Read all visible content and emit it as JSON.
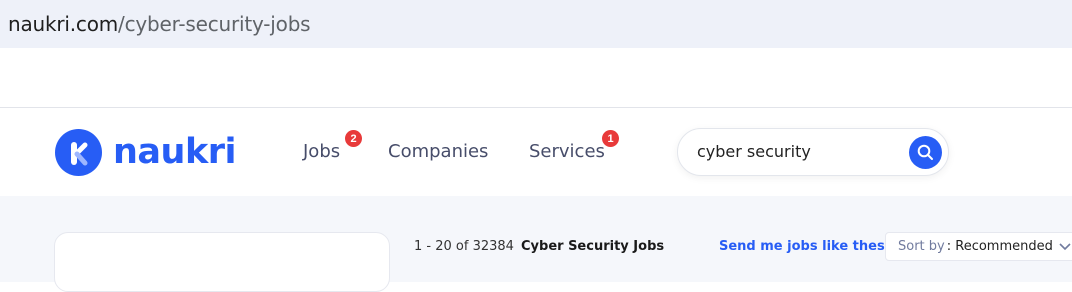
{
  "browser": {
    "url_host": "naukri.com",
    "url_path": "/cyber-security-jobs"
  },
  "header": {
    "logo_text": "naukri",
    "nav": {
      "jobs": {
        "label": "Jobs",
        "badge": "2"
      },
      "companies": {
        "label": "Companies"
      },
      "services": {
        "label": "Services",
        "badge": "1"
      }
    },
    "search": {
      "value": "cyber security",
      "icon": "search-icon"
    }
  },
  "results": {
    "count_text": "1 - 20 of 32384",
    "query_title": "Cyber Security Jobs",
    "send_jobs_label": "Send me jobs like these",
    "sort_label": "Sort by",
    "sort_value": ": Recommended"
  },
  "colors": {
    "brand_blue": "#275df5",
    "badge_red": "#e83a3a",
    "nav_text": "#474d6a"
  }
}
